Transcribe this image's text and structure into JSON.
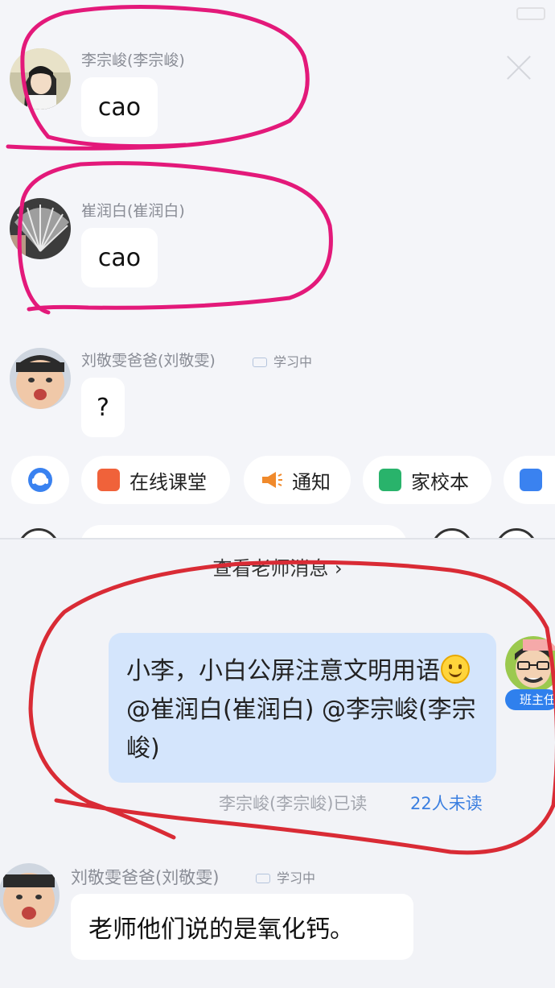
{
  "top_panel": {
    "messages": [
      {
        "sender": "李宗峻(李宗峻)",
        "text": "cao"
      },
      {
        "sender": "崔润白(崔润白)",
        "text": "cao"
      },
      {
        "sender": "刘敬雯爸爸(刘敬雯)",
        "status": "学习中",
        "text": "?"
      }
    ],
    "quick_actions": [
      {
        "label": "在线课堂",
        "icon": "online-class-icon",
        "color": "#f0623a"
      },
      {
        "label": "通知",
        "icon": "megaphone-icon",
        "color": "#f08a2c"
      },
      {
        "label": "家校本",
        "icon": "notebook-icon",
        "color": "#29b36b"
      },
      {
        "label": "",
        "icon": "contacts-icon",
        "color": "#3a82f0"
      }
    ]
  },
  "bottom_panel": {
    "view_teacher_link": "查看老师消息 ›",
    "teacher_message": {
      "text_before_emoji": "小李，小白公屏注意文明用语",
      "text_after_emoji": "@崔润白(崔润白) @李宗峻(李宗峻)",
      "badge": "班主任",
      "read_by": "李宗峻(李宗峻)已读",
      "unread": "22人未读"
    },
    "reply": {
      "sender": "刘敬雯爸爸(刘敬雯)",
      "status": "学习中",
      "text": "老师他们说的是氧化钙。"
    }
  },
  "colors": {
    "accent_blue": "#3b7fe0",
    "teacher_bubble": "#d4e5fc",
    "annotation_pink": "#e3197a",
    "annotation_red": "#d92b35"
  }
}
